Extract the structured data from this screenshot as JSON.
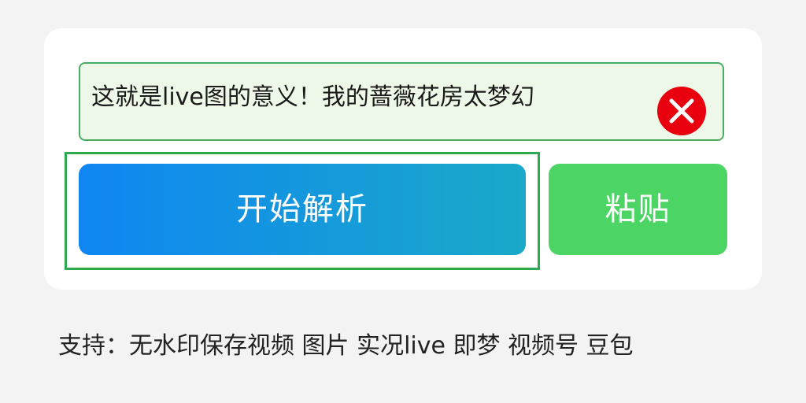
{
  "input": {
    "value": "这就是live图的意义！我的蔷薇花房太梦幻",
    "clear_icon": "close-circle-icon"
  },
  "buttons": {
    "parse_label": "开始解析",
    "paste_label": "粘贴"
  },
  "footer": {
    "support_text": "支持：无水印保存视频 图片 实况live 即梦 视频号 豆包"
  },
  "colors": {
    "parse_gradient_start": "#0f86f2",
    "parse_gradient_end": "#1aa9c8",
    "paste_bg": "#4cd565",
    "input_bg": "#eef8e8",
    "input_border": "#4cae63",
    "clear_icon_bg": "#e8000f",
    "focus_frame": "#2fa84f"
  }
}
